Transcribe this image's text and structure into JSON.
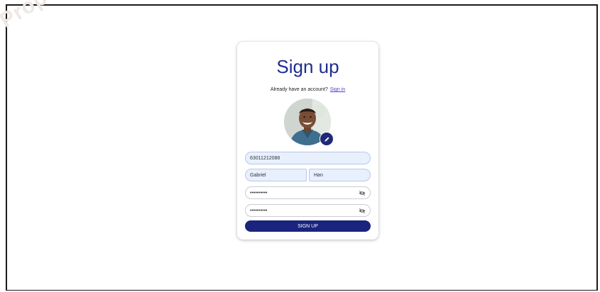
{
  "watermark": "Property of",
  "signup": {
    "title": "Sign up",
    "already_text": "Already have an account?",
    "signin_link": "Sign in",
    "phone_value": "63011212088",
    "first_name_value": "Gabriel",
    "last_name_value": "Han",
    "password_value": "••••••••••",
    "confirm_password_value": "••••••••••",
    "submit_label": "SIGN UP"
  },
  "icons": {
    "edit": "pencil-icon",
    "toggle_visibility": "eye-slash-icon"
  },
  "colors": {
    "primary": "#1a237e",
    "title": "#1f2d8f",
    "link": "#5b3cc4",
    "field_fill": "#e8f0fe"
  }
}
